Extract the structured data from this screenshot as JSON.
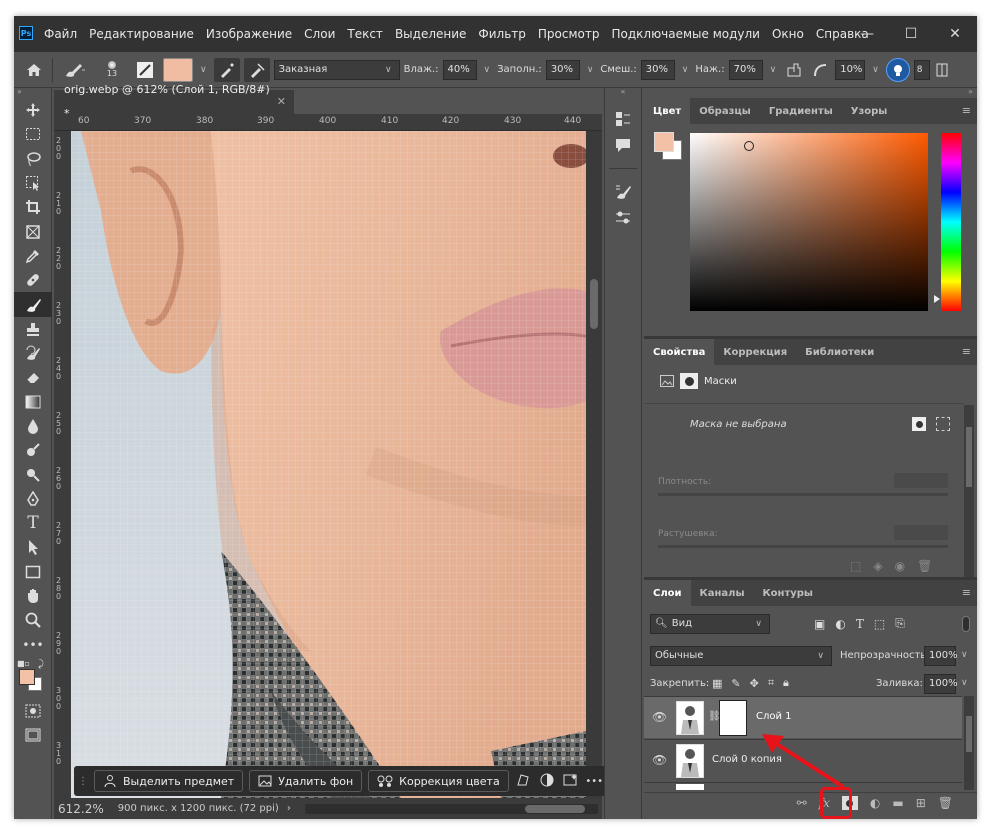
{
  "app": {
    "logo": "Ps",
    "menu": [
      "Файл",
      "Редактирование",
      "Изображение",
      "Слои",
      "Текст",
      "Выделение",
      "Фильтр",
      "Просмотр",
      "Подключаемые модули",
      "Окно",
      "Справка"
    ]
  },
  "window_controls": {
    "minimize": "—",
    "maximize": "☐",
    "close": "✕"
  },
  "options": {
    "brush_size": "13",
    "mode_value": "Заказная",
    "wet_label": "Влаж.:",
    "wet_value": "40%",
    "load_label": "Заполн.:",
    "load_value": "30%",
    "mix_label": "Смеш.:",
    "mix_value": "30%",
    "flow_label": "Наж.:",
    "flow_value": "70%",
    "angle_value": "10%",
    "smoothing_value": "8"
  },
  "document": {
    "tab_title": "orig.webp @ 612% (Слой 1, RGB/8#) *",
    "ruler_top": [
      "60",
      "370",
      "380",
      "390",
      "400",
      "410",
      "420",
      "430",
      "440"
    ],
    "ruler_left": [
      "2 0 0",
      "2 1 0",
      "2 2 0",
      "2 3 0",
      "2 4 0",
      "2 5 0",
      "2 6 0",
      "2 7 0",
      "2 8 0",
      "2 9 0",
      "3 0 0",
      "3 1 0"
    ],
    "zoom": "612.2%",
    "info": "900 пикс. x 1200 пикс. (72 ppi)"
  },
  "contextbar": {
    "select_subject": "Выделить предмет",
    "remove_bg": "Удалить фон",
    "color_correction": "Коррекция цвета",
    "more": "•••"
  },
  "color_panel": {
    "tabs": [
      "Цвет",
      "Образцы",
      "Градиенты",
      "Узоры"
    ],
    "fg_color": "#f3c1a6"
  },
  "properties_panel": {
    "tabs": [
      "Свойства",
      "Коррекция",
      "Библиотеки"
    ],
    "section": "Маски",
    "no_mask": "Маска не выбрана",
    "density_label": "Плотность:",
    "feather_label": "Растушевка:"
  },
  "layers_panel": {
    "tabs": [
      "Слои",
      "Каналы",
      "Контуры"
    ],
    "filter_kind": "Вид",
    "blend_mode": "Обычные",
    "opacity_label": "Непрозрачность:",
    "opacity_value": "100%",
    "lock_label": "Закрепить:",
    "fill_label": "Заливка:",
    "fill_value": "100%",
    "layers": [
      {
        "name": "Слой 1",
        "selected": true,
        "has_mask": true
      },
      {
        "name": "Слой 0 копия",
        "selected": false,
        "has_mask": false
      }
    ]
  },
  "annotation": {
    "color": "#e8131a"
  }
}
